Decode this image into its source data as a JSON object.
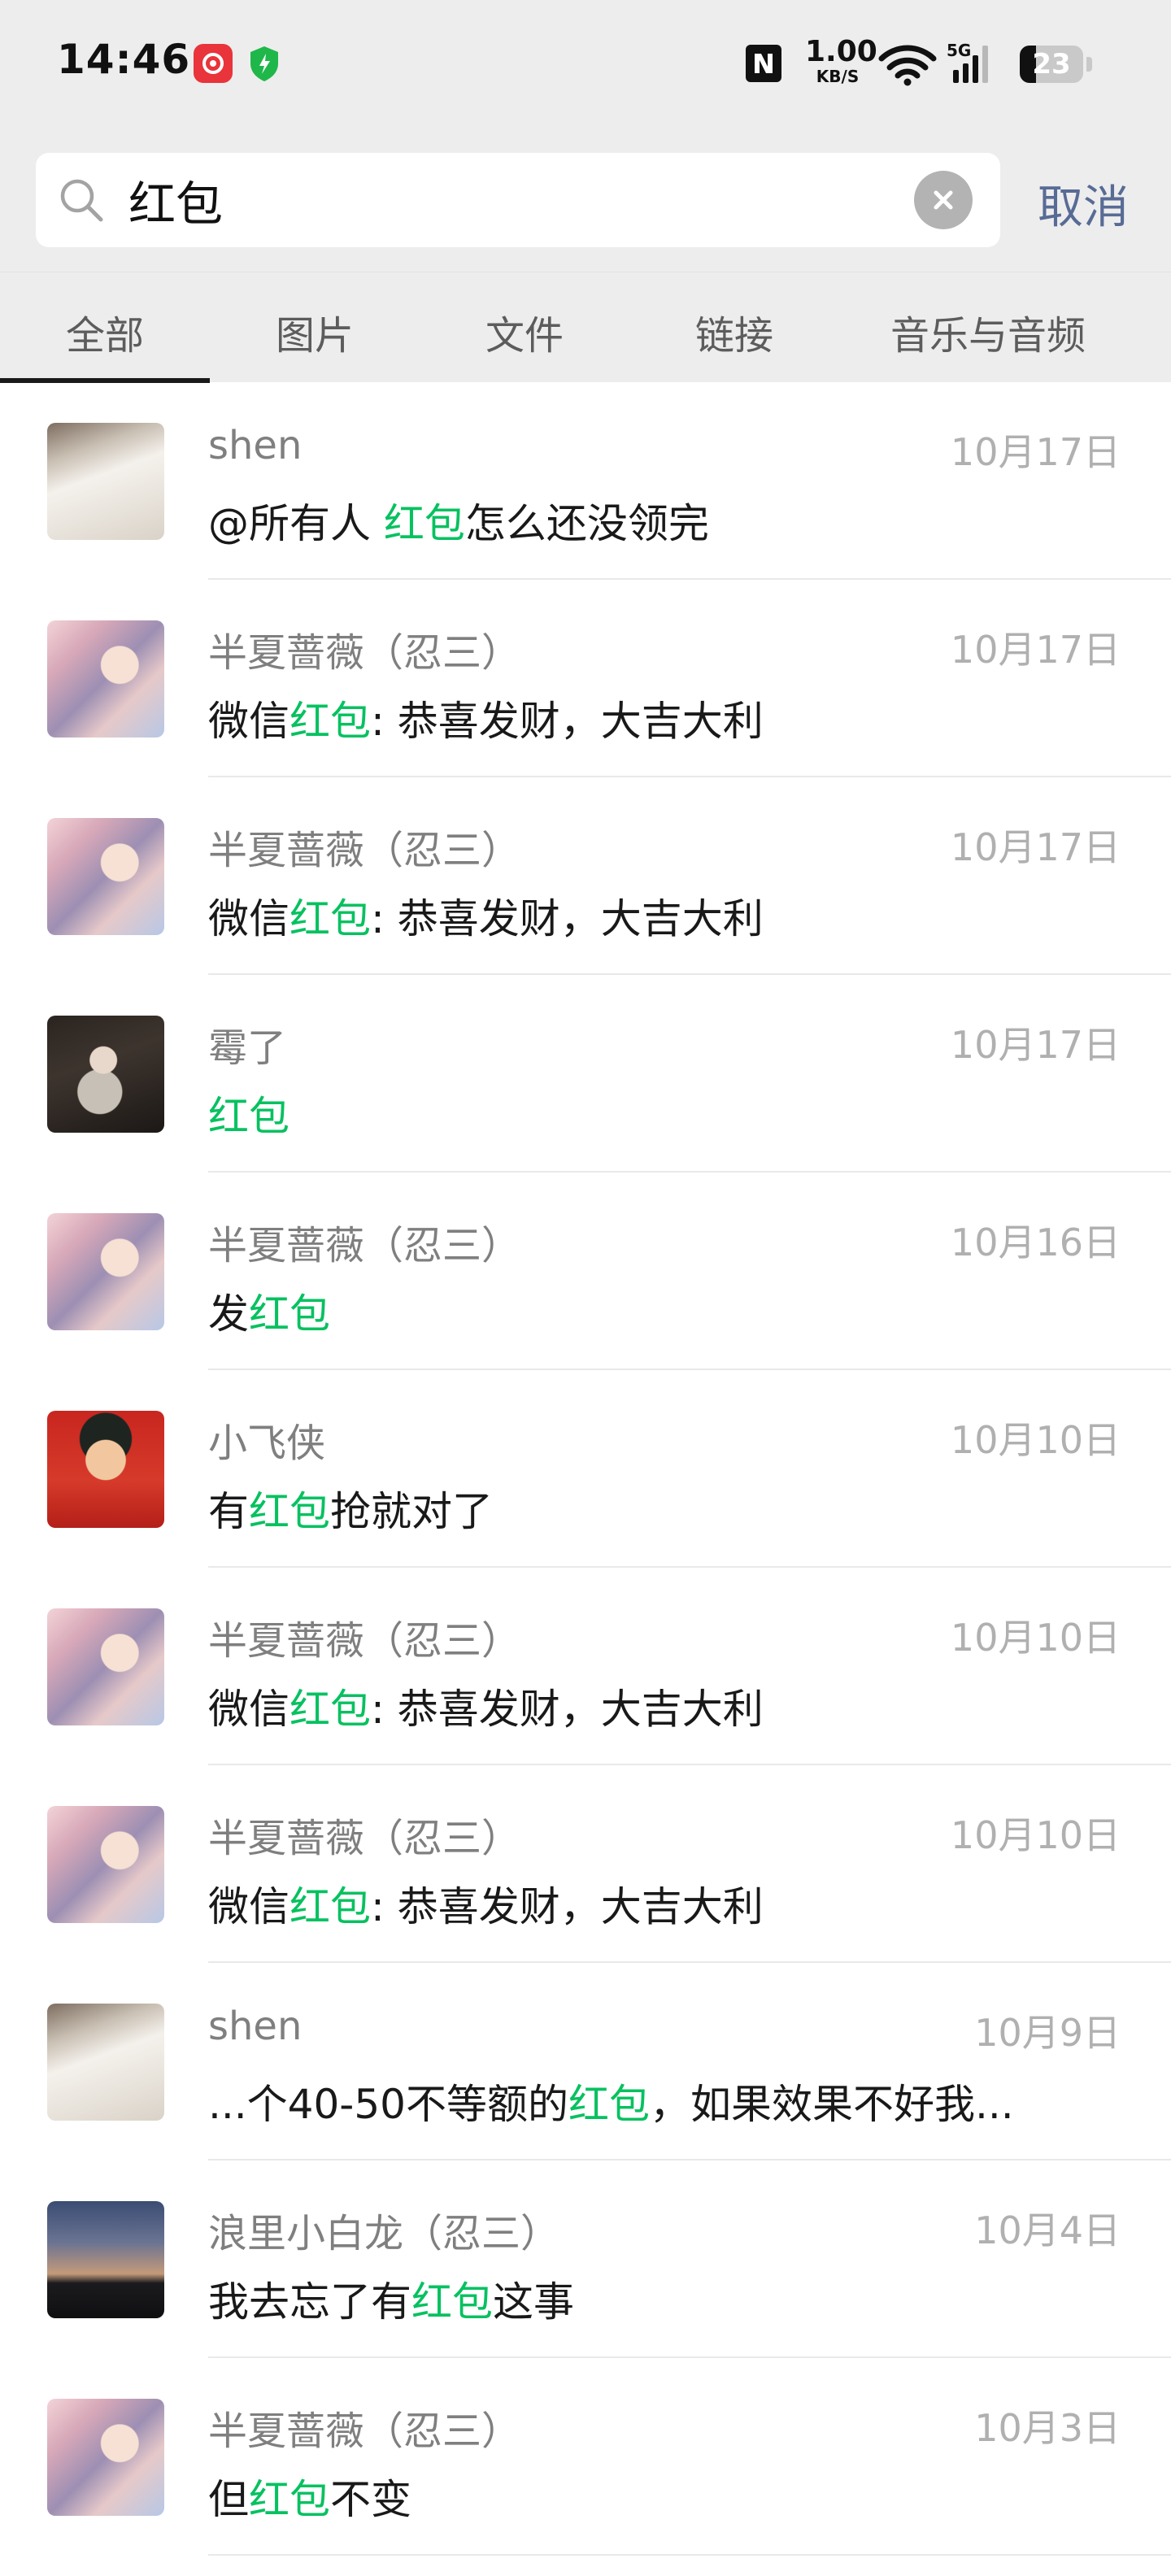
{
  "status_bar": {
    "time": "14:46",
    "net_speed_value": "1.00",
    "net_speed_unit": "KB/S",
    "network_type": "5G",
    "battery_percent": "23"
  },
  "search": {
    "query": "红包",
    "cancel_label": "取消"
  },
  "tabs": [
    {
      "label": "全部",
      "active": true
    },
    {
      "label": "图片",
      "active": false
    },
    {
      "label": "文件",
      "active": false
    },
    {
      "label": "链接",
      "active": false
    },
    {
      "label": "音乐与音频",
      "active": false
    }
  ],
  "colors": {
    "highlight": "#07c160",
    "cancel": "#576b95",
    "top_background": "#ededed"
  },
  "results": [
    {
      "sender": "shen",
      "date": "10月17日",
      "msg_before": "@所有人 ",
      "msg_highlight": "红包",
      "msg_after": "怎么还没领完",
      "avatar": "shen"
    },
    {
      "sender": "半夏蔷薇（忍三）",
      "date": "10月17日",
      "msg_before": "微信",
      "msg_highlight": "红包",
      "msg_after": ": 恭喜发财，大吉大利",
      "avatar": "banxia"
    },
    {
      "sender": "半夏蔷薇（忍三）",
      "date": "10月17日",
      "msg_before": "微信",
      "msg_highlight": "红包",
      "msg_after": ": 恭喜发财，大吉大利",
      "avatar": "banxia"
    },
    {
      "sender": "霉了",
      "date": "10月17日",
      "msg_before": "",
      "msg_highlight": "红包",
      "msg_after": "",
      "avatar": "mei"
    },
    {
      "sender": "半夏蔷薇（忍三）",
      "date": "10月16日",
      "msg_before": "发",
      "msg_highlight": "红包",
      "msg_after": "",
      "avatar": "banxia"
    },
    {
      "sender": "小飞侠",
      "date": "10月10日",
      "msg_before": "有",
      "msg_highlight": "红包",
      "msg_after": "抢就对了",
      "avatar": "xiaofei"
    },
    {
      "sender": "半夏蔷薇（忍三）",
      "date": "10月10日",
      "msg_before": "微信",
      "msg_highlight": "红包",
      "msg_after": ": 恭喜发财，大吉大利",
      "avatar": "banxia"
    },
    {
      "sender": "半夏蔷薇（忍三）",
      "date": "10月10日",
      "msg_before": "微信",
      "msg_highlight": "红包",
      "msg_after": ": 恭喜发财，大吉大利",
      "avatar": "banxia"
    },
    {
      "sender": "shen",
      "date": "10月9日",
      "msg_before": "...个40-50不等额的",
      "msg_highlight": "红包",
      "msg_after": "，如果效果不好我...",
      "avatar": "shen"
    },
    {
      "sender": "浪里小白龙（忍三）",
      "date": "10月4日",
      "msg_before": "我去忘了有",
      "msg_highlight": "红包",
      "msg_after": "这事",
      "avatar": "langli"
    },
    {
      "sender": "半夏蔷薇（忍三）",
      "date": "10月3日",
      "msg_before": "但",
      "msg_highlight": "红包",
      "msg_after": "不变",
      "avatar": "banxia"
    }
  ]
}
